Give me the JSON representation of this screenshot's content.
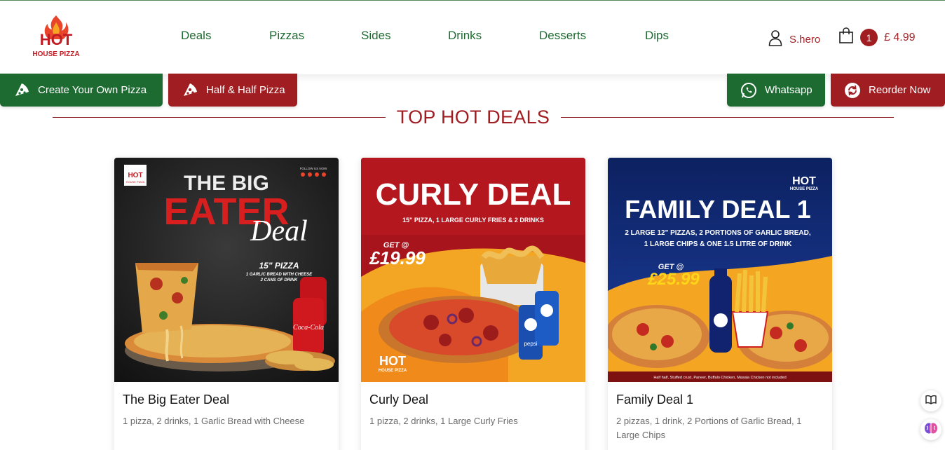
{
  "brand": {
    "logo_top": "HOT",
    "logo_bottom": "HOUSE PIZZA"
  },
  "nav": [
    {
      "label": "Deals"
    },
    {
      "label": "Pizzas"
    },
    {
      "label": "Sides"
    },
    {
      "label": "Drinks"
    },
    {
      "label": "Desserts"
    },
    {
      "label": "Dips"
    }
  ],
  "user": {
    "name": "S.hero",
    "icon": "user-icon"
  },
  "cart": {
    "count": "1",
    "total": "£ 4.99",
    "icon": "shopping-bag-icon"
  },
  "actions": {
    "create_pizza": "Create Your Own Pizza",
    "half_half": "Half & Half Pizza",
    "whatsapp": "Whatsapp",
    "reorder": "Reorder Now"
  },
  "section": {
    "title": "TOP HOT DEALS"
  },
  "deals": [
    {
      "title": "The Big Eater Deal",
      "desc": "1 pizza, 2 drinks, 1 Garlic Bread with Cheese",
      "img": {
        "line1": "THE BIG",
        "line2": "EATER",
        "line3": "Deal",
        "sub1": "15\" PIZZA",
        "sub2": "1 GARLIC BREAD WITH CHEESE",
        "sub3": "2 CANS OF DRINK",
        "follow": "FOLLOW US NOW",
        "logo_top": "HOT",
        "logo_bottom": "HOUSE PIZZA"
      }
    },
    {
      "title": "Curly Deal",
      "desc": "1 pizza, 2 drinks, 1 Large Curly Fries",
      "img": {
        "headline": "CURLY DEAL",
        "sub": "15\" PIZZA, 1 LARGE CURLY FRIES & 2 DRINKS",
        "get": "GET @",
        "price": "£19.99",
        "logo_top": "HOT",
        "logo_bottom": "HOUSE PIZZA",
        "can": "pepsi"
      }
    },
    {
      "title": "Family Deal 1",
      "desc": "2 pizzas, 1 drink, 2 Portions of Garlic Bread, 1 Large Chips",
      "img": {
        "headline": "FAMILY DEAL 1",
        "sub1": "2 LARGE 12\" PIZZAS, 2 PORTIONS OF GARLIC BREAD,",
        "sub2": "1 LARGE CHIPS & ONE 1.5 LITRE OF DRINK",
        "get": "GET @",
        "price": "£25.99",
        "footnote": "Half half, Stuffed crust, Paneer, Buffalo Chicken, Masala Chicken not included",
        "logo_top": "HOT",
        "logo_bottom": "HOUSE PIZZA"
      }
    }
  ],
  "colors": {
    "green": "#1e6b32",
    "red": "#a01e22"
  }
}
